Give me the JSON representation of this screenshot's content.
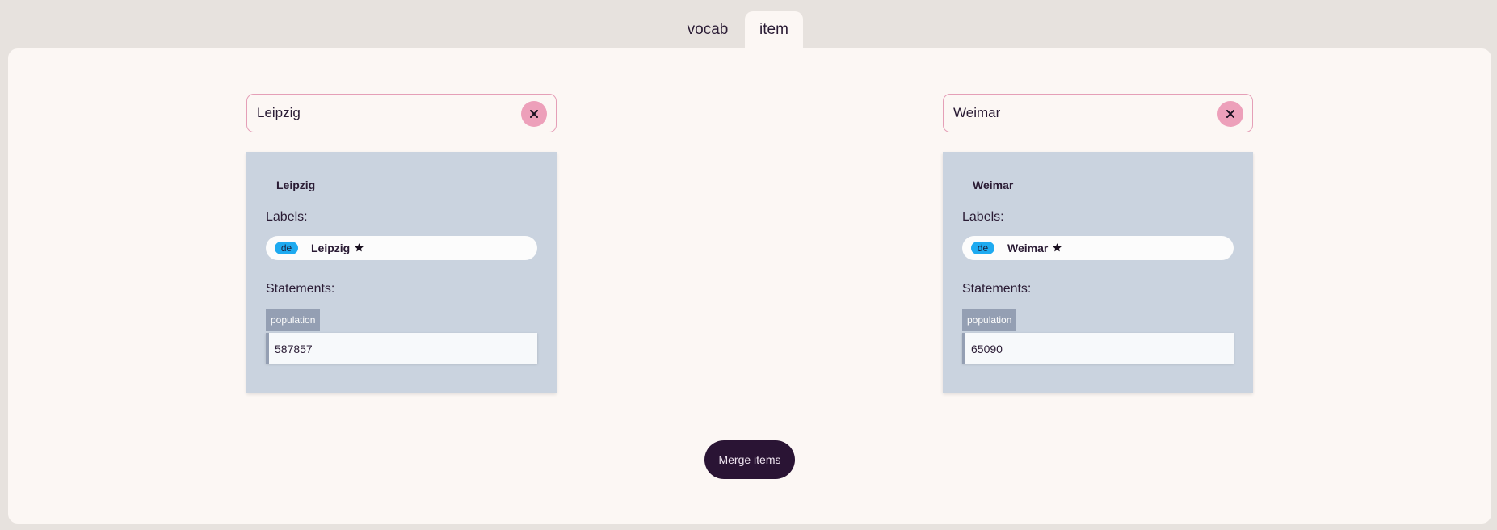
{
  "tabs": [
    {
      "label": "vocab",
      "active": false
    },
    {
      "label": "item",
      "active": true
    }
  ],
  "left": {
    "search_value": "Leipzig",
    "card": {
      "title": "Leipzig",
      "labels_heading": "Labels:",
      "label": {
        "lang": "de",
        "text": "Leipzig",
        "preferred_icon": "star-icon"
      },
      "statements_heading": "Statements:",
      "statement": {
        "property": "population",
        "value": "587857"
      }
    }
  },
  "right": {
    "search_value": "Weimar",
    "card": {
      "title": "Weimar",
      "labels_heading": "Labels:",
      "label": {
        "lang": "de",
        "text": "Weimar",
        "preferred_icon": "star-icon"
      },
      "statements_heading": "Statements:",
      "statement": {
        "property": "population",
        "value": "65090"
      }
    }
  },
  "merge_button": "Merge items",
  "colors": {
    "accent_pink": "#eda0ba",
    "card_bg": "#cad3df",
    "lang_badge": "#1eaaf0",
    "merge_bg": "#2a1434"
  }
}
